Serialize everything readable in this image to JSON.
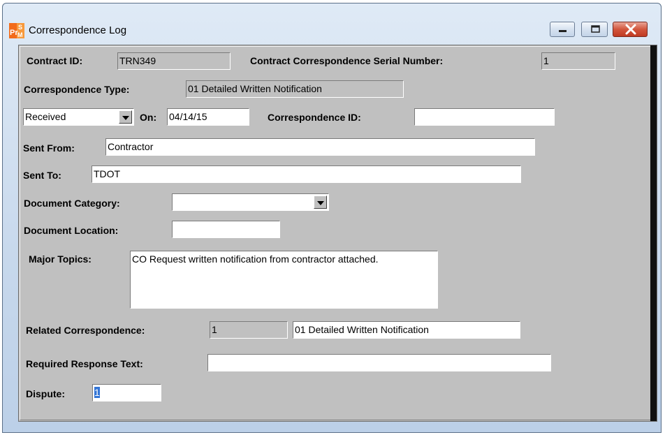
{
  "window": {
    "title": "Correspondence Log"
  },
  "form": {
    "contract_id_label": "Contract ID:",
    "contract_id_value": "TRN349",
    "serial_label": "Contract Correspondence Serial Number:",
    "serial_value": "1",
    "type_label": "Correspondence Type:",
    "type_value": "01 Detailed Written Notification",
    "direction_value": "Received",
    "on_label": "On:",
    "on_value": "04/14/15",
    "corr_id_label": "Correspondence ID:",
    "corr_id_value": "",
    "sent_from_label": "Sent From:",
    "sent_from_value": "Contractor",
    "sent_to_label": "Sent To:",
    "sent_to_value": "TDOT",
    "doc_category_label": "Document Category:",
    "doc_category_value": "",
    "doc_location_label": "Document Location:",
    "doc_location_value": "",
    "major_topics_label": "Major Topics:",
    "major_topics_value": "CO Request written notification from contractor attached.",
    "related_label": "Related Correspondence:",
    "related_number": "1",
    "related_text": "01 Detailed Written Notification",
    "required_response_label": "Required Response Text:",
    "required_response_value": "",
    "dispute_label": "Dispute:",
    "dispute_value": "1"
  },
  "icons": {
    "app": "psm-app-icon",
    "minimize": "minimize-icon",
    "maximize": "maximize-icon",
    "close": "close-icon"
  },
  "colors": {
    "close_button": "#c03a22",
    "form_background": "#c0c0c0",
    "selection": "#3375d6"
  }
}
